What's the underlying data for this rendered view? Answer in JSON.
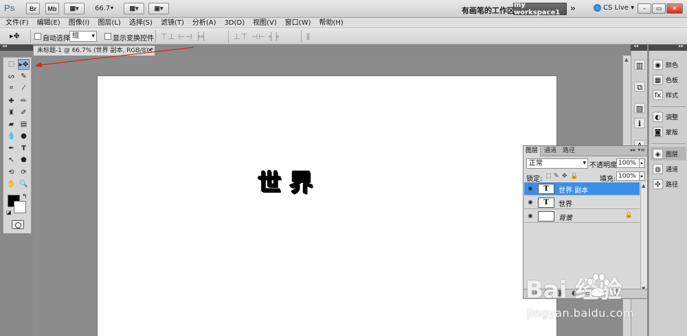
{
  "app": {
    "logo": "Ps",
    "bridge_btn": "Br",
    "minibridge_btn": "Mb",
    "zoom": "66.7",
    "workspace_text": "有画笔的工作区",
    "workspace_button": "my workspace1",
    "more": "»",
    "cs_live": "CS Live ▾",
    "minimize": "–",
    "restore": "▭",
    "close": "✕"
  },
  "menu": [
    "文件(F)",
    "编辑(E)",
    "图像(I)",
    "图层(L)",
    "选择(S)",
    "滤镜(T)",
    "分析(A)",
    "3D(D)",
    "视图(V)",
    "窗口(W)",
    "帮助(H)"
  ],
  "options": {
    "tool_icon": "▸✥",
    "auto_select_label": "自动选择:",
    "auto_select_value": "组",
    "transform_label": "显示变换控件",
    "align_icons_1": "⊤⊥ ⊢⊣ ╞╡",
    "align_icons_2": "⊥⊤ ⊣⊢ ╡╞",
    "distribute_icon": "⫼"
  },
  "document": {
    "tab_title": "未标题-1 @ 66.7% (世界 副本, RGB/8) *",
    "tab_close": "✕",
    "canvas_text": "世界"
  },
  "dock": {
    "items": [
      {
        "label": "颜色",
        "icon": "palette-icon",
        "glyph": "◉"
      },
      {
        "label": "色板",
        "icon": "swatches-icon",
        "glyph": "▦"
      },
      {
        "label": "样式",
        "icon": "styles-icon",
        "glyph": "fx"
      },
      {
        "label": "调整",
        "icon": "adjustments-icon",
        "glyph": "◐"
      },
      {
        "label": "蒙版",
        "icon": "masks-icon",
        "glyph": "◙"
      },
      {
        "label": "图层",
        "icon": "layers-icon",
        "glyph": "◈"
      },
      {
        "label": "通道",
        "icon": "channels-icon",
        "glyph": "◍"
      },
      {
        "label": "路径",
        "icon": "paths-icon",
        "glyph": "✣"
      }
    ]
  },
  "layers_panel": {
    "tabs": [
      "图层",
      "通道",
      "路径"
    ],
    "menu": "▸▸ ▾≡",
    "blend_mode": "正常",
    "opacity_label": "不透明度:",
    "opacity": "100%",
    "lock_label": "锁定:",
    "fill_label": "填充:",
    "fill": "100%",
    "layers": [
      {
        "name": "世界 副本",
        "thumb": "T",
        "selected": true
      },
      {
        "name": "世界",
        "thumb": "T",
        "selected": false
      },
      {
        "name": "背景",
        "thumb": "",
        "selected": false,
        "locked": true
      }
    ]
  },
  "watermark": {
    "brand": "Bai  经验",
    "url": "jingyan.baidu.com"
  }
}
